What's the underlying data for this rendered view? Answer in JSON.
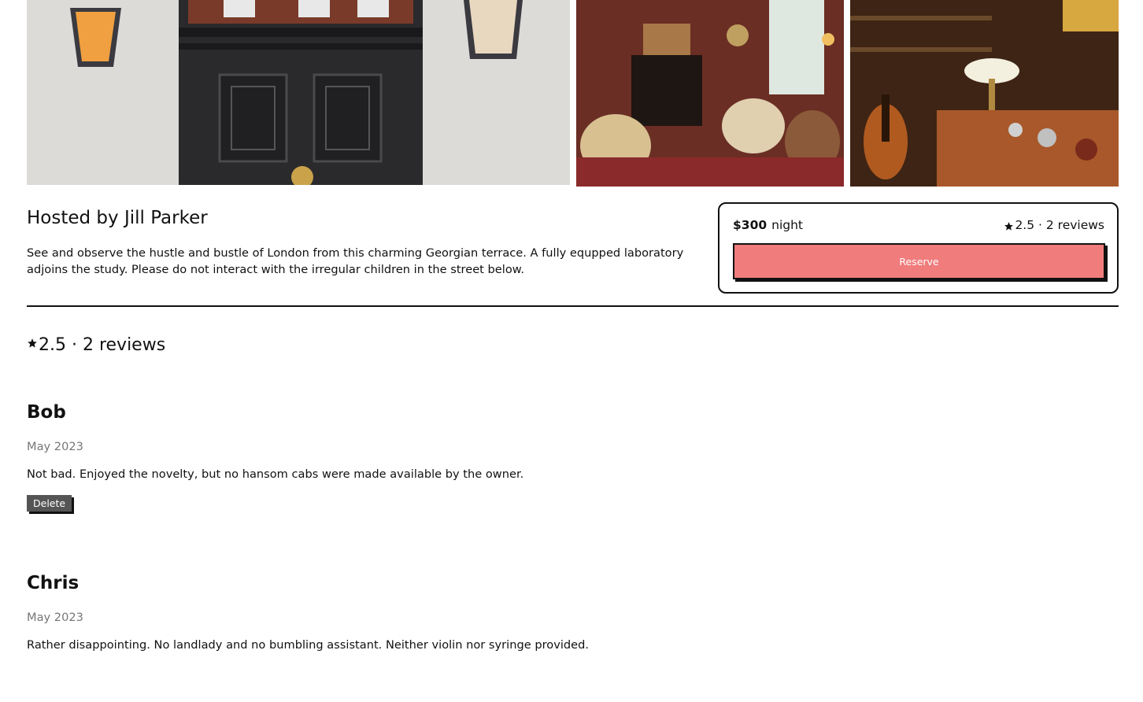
{
  "listing": {
    "host_title": "Hosted by Jill Parker",
    "description": "See and observe the hustle and bustle of London from this charming Georgian terrace. A fully equpped laboratory adjoins the study. Please do not interact with the irregular children in the street below."
  },
  "booking": {
    "price": "$300",
    "price_unit": "night",
    "rating_summary": "2.5 · 2 reviews",
    "reserve_label": "Reserve"
  },
  "reviews_section": {
    "summary": "2.5 · 2 reviews",
    "reviews": [
      {
        "name": "Bob",
        "date": "May 2023",
        "text": "Not bad. Enjoyed the novelty, but no hansom cabs were made available by the owner.",
        "delete_label": "Delete"
      },
      {
        "name": "Chris",
        "date": "May 2023",
        "text": "Rather disappointing. No landlady and no bumbling assistant. Neither violin nor syringe provided."
      }
    ]
  },
  "icons": {
    "rating": "star-icon"
  },
  "colors": {
    "reserve_button": "#f07c7c",
    "delete_button": "#555555",
    "muted_text": "#767676"
  }
}
